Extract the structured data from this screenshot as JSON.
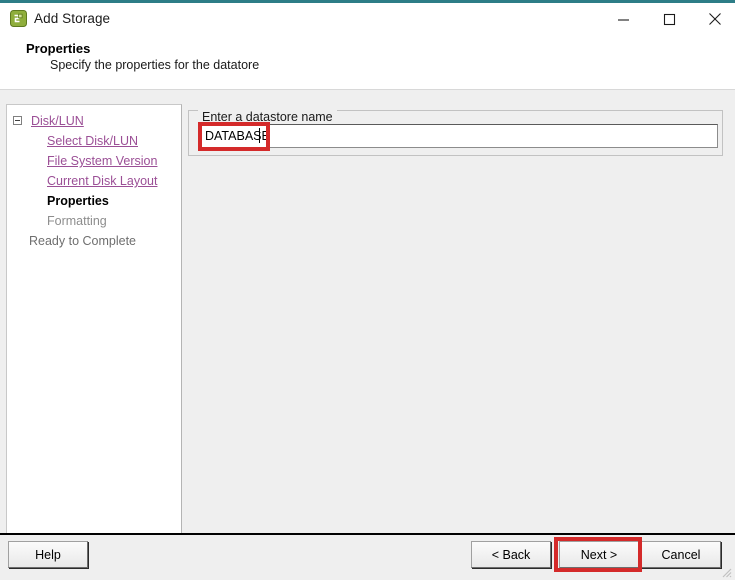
{
  "window": {
    "title": "Add Storage",
    "app_icon": "storage-wizard-icon",
    "accent_color": "#2d7d87",
    "highlight_color": "#d42a2a",
    "controls": {
      "minimize": "minimize-icon",
      "maximize": "maximize-icon",
      "close": "close-icon"
    }
  },
  "header": {
    "title": "Properties",
    "subtitle": "Specify the properties for the datatore"
  },
  "sidebar": {
    "items": [
      {
        "label": "Disk/LUN",
        "level": 0,
        "state": "link",
        "expander": true
      },
      {
        "label": "Select Disk/LUN",
        "level": 1,
        "state": "link",
        "expander": false
      },
      {
        "label": "File System Version",
        "level": 1,
        "state": "link",
        "expander": false
      },
      {
        "label": "Current Disk Layout",
        "level": 1,
        "state": "link",
        "expander": false
      },
      {
        "label": "Properties",
        "level": 1,
        "state": "current",
        "expander": false
      },
      {
        "label": "Formatting",
        "level": 1,
        "state": "dim",
        "expander": false
      },
      {
        "label": "Ready to Complete",
        "level": 0,
        "state": "plain",
        "expander": false
      }
    ]
  },
  "main": {
    "groupbox_legend": "Enter a datastore name",
    "datastore_name": {
      "value": "DATABASE",
      "placeholder": ""
    }
  },
  "footer": {
    "help_label": "Help",
    "back_label": "< Back",
    "next_label": "Next >",
    "cancel_label": "Cancel"
  }
}
